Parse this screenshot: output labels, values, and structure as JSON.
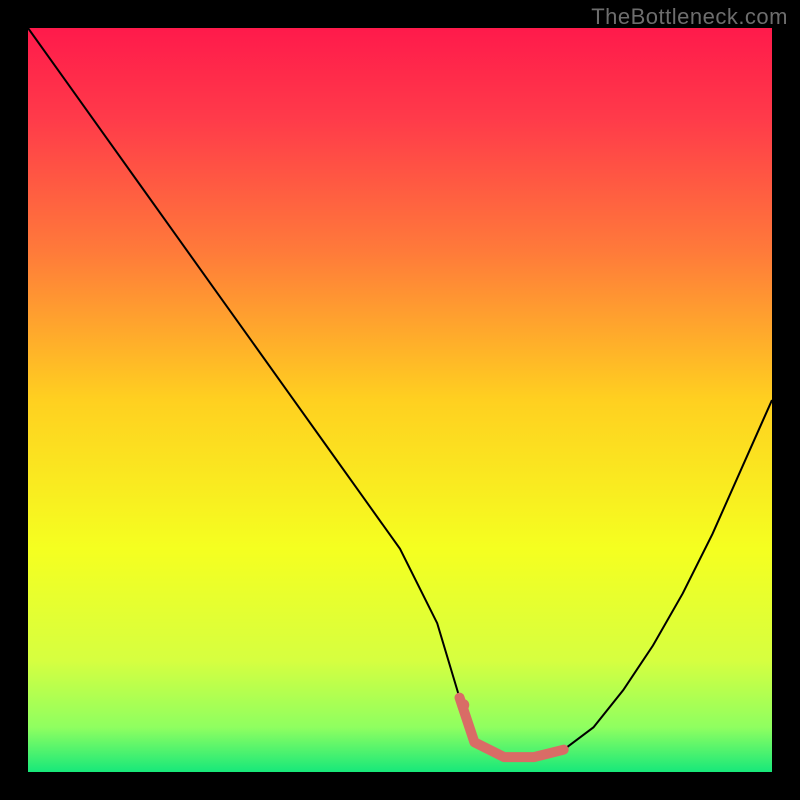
{
  "watermark": "TheBottleneck.com",
  "chart_data": {
    "type": "line",
    "title": "",
    "xlabel": "",
    "ylabel": "",
    "xlim": [
      0,
      100
    ],
    "ylim": [
      0,
      100
    ],
    "background_gradient": {
      "stops": [
        {
          "offset": 0.0,
          "color": "#ff1a4b"
        },
        {
          "offset": 0.12,
          "color": "#ff3a4a"
        },
        {
          "offset": 0.3,
          "color": "#ff7a3a"
        },
        {
          "offset": 0.5,
          "color": "#ffd020"
        },
        {
          "offset": 0.7,
          "color": "#f5ff20"
        },
        {
          "offset": 0.85,
          "color": "#d6ff40"
        },
        {
          "offset": 0.94,
          "color": "#8fff60"
        },
        {
          "offset": 1.0,
          "color": "#17e87a"
        }
      ]
    },
    "series": [
      {
        "name": "bottleneck-curve",
        "color": "#000000",
        "stroke_width": 2,
        "x": [
          0,
          5,
          10,
          15,
          20,
          25,
          30,
          35,
          40,
          45,
          50,
          55,
          58,
          60,
          64,
          68,
          72,
          76,
          80,
          84,
          88,
          92,
          96,
          100
        ],
        "y": [
          100,
          93,
          86,
          79,
          72,
          65,
          58,
          51,
          44,
          37,
          30,
          20,
          10,
          4,
          2,
          2,
          3,
          6,
          11,
          17,
          24,
          32,
          41,
          50
        ]
      },
      {
        "name": "highlight-segment",
        "color": "#d96c66",
        "stroke_width": 10,
        "linecap": "round",
        "x": [
          58,
          60,
          64,
          68,
          72
        ],
        "y": [
          10,
          4,
          2,
          2,
          3
        ]
      }
    ],
    "markers": [
      {
        "name": "highlight-dot",
        "x": 58.5,
        "y": 9,
        "r": 6,
        "color": "#d96c66"
      }
    ]
  }
}
